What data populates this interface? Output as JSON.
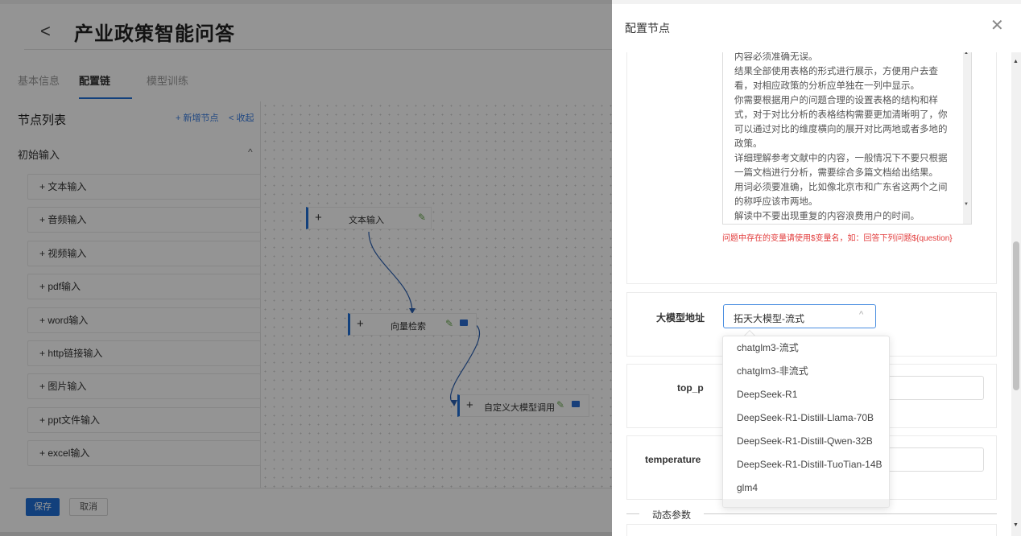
{
  "app": {
    "title": "产业政策智能问答",
    "tabs": [
      "基本信息",
      "配置链",
      "模型训练"
    ],
    "active_tab": "配置链"
  },
  "sidebar": {
    "title": "节点列表",
    "add_label": "+ 新增节点",
    "collapse_label": "< 收起",
    "group": "初始输入",
    "items": [
      "+ 文本输入",
      "+ 音频输入",
      "+ 视频输入",
      "+ pdf输入",
      "+ word输入",
      "+ http链接输入",
      "+ 图片输入",
      "+ ppt文件输入",
      "+ excel输入"
    ]
  },
  "canvas": {
    "nodes": [
      {
        "label": "文本输入"
      },
      {
        "label": "向量检索"
      },
      {
        "label": "自定义大模型调用"
      }
    ]
  },
  "footer": {
    "save": "保存",
    "cancel": "取消"
  },
  "drawer": {
    "title": "配置节点",
    "prompt_text": "内容必须准确无误。\n结果全部使用表格的形式进行展示，方便用户去查看，对相应政策的分析应单独在一列中显示。\n你需要根据用户的问题合理的设置表格的结构和样式，对于对比分析的表格结构需要更加清晰明了，你可以通过对比的维度横向的展开对比两地或者多地的政策。\n详细理解参考文献中的内容，一般情况下不要只根据一篇文档进行分析，需要综合多篇文档给出结果。\n用词必须要准确，比如像北京市和广东省这两个之间的称呼应该市两地。\n解读中不要出现重复的内容浪费用户的时间。",
    "prompt_hint": "问题中存在的变量请使用$变量名，如：回答下列问题${question}",
    "model_label": "大模型地址",
    "model_value": "拓天大模型-流式",
    "top_p_label": "top_p",
    "temperature_label": "temperature",
    "dynamic_params": "动态参数",
    "model_options": [
      "chatglm3-流式",
      "chatglm3-非流式",
      "DeepSeek-R1",
      "DeepSeek-R1-Distill-Llama-70B",
      "DeepSeek-R1-Distill-Qwen-32B",
      "DeepSeek-R1-Distill-TuoTian-14B",
      "glm4"
    ]
  },
  "colors": {
    "accent": "#1f6fd6",
    "hint": "#e23b3b",
    "overlay": "rgba(0,0,0,0.42)"
  },
  "icons": {
    "back": "chevron-left-icon",
    "close": "close-icon",
    "edit": "pencil-icon",
    "monitor": "monitor-icon"
  }
}
